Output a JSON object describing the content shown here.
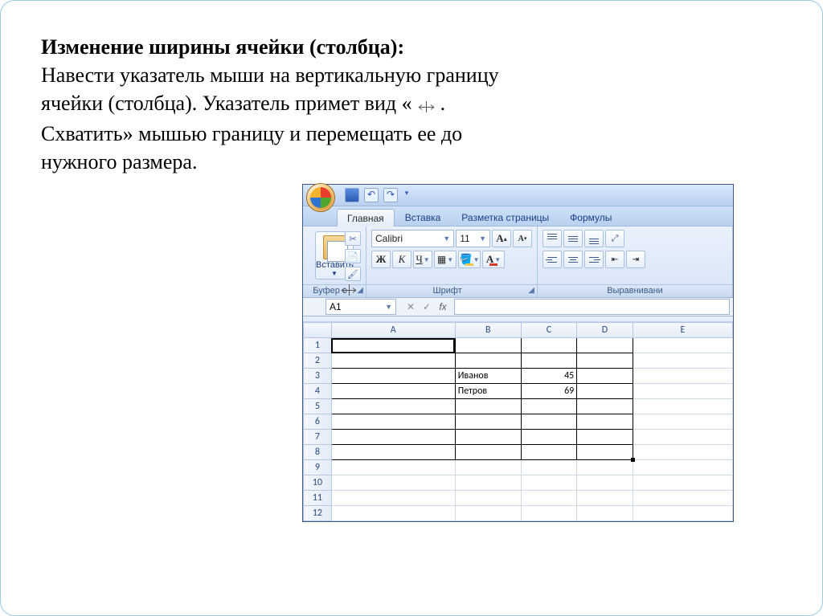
{
  "intro": {
    "heading": "Изменение ширины ячейки (столбца):",
    "p1": "Навести указатель мыши на вертикальную границу",
    "p2a": "ячейки (столбца). Указатель примет вид ",
    "p2b": "« ",
    "p2c": ".",
    "p3": "Схватить» мышью границу и перемещать ее до",
    "p4": "нужного размера."
  },
  "excel": {
    "qat": {
      "save": "",
      "undo": "",
      "redo": "",
      "more": "▾"
    },
    "tabs": {
      "home": "Главная",
      "insert": "Вставка",
      "pagelayout": "Разметка страницы",
      "formulas": "Формулы"
    },
    "ribbon": {
      "clipboard": {
        "paste": "Вставить",
        "label": "Буфер о"
      },
      "font": {
        "name": "Calibri",
        "size": "11",
        "bold": "Ж",
        "italic": "К",
        "underline": "Ч",
        "growA": "A",
        "shrinkA": "A",
        "clearA": "A",
        "label": "Шрифт"
      },
      "align": {
        "label": "Выравнивани"
      }
    },
    "namebox": "A1",
    "fx": "fx",
    "columns": [
      "A",
      "B",
      "C",
      "D",
      "E"
    ],
    "rows": [
      "1",
      "2",
      "3",
      "4",
      "5",
      "6",
      "7",
      "8",
      "9",
      "10",
      "11",
      "12"
    ],
    "data": {
      "B3": "Иванов",
      "C3": "45",
      "B4": "Петров",
      "C4": "69"
    }
  }
}
